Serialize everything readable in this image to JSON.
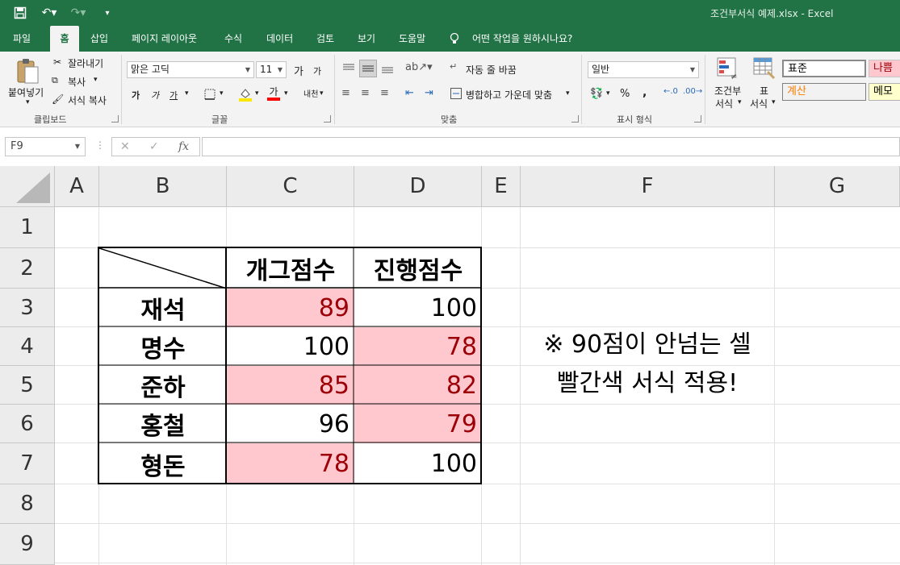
{
  "window": {
    "title": "조건부서식 예제.xlsx  -  Excel"
  },
  "tabs": [
    "파일",
    "홈",
    "삽입",
    "페이지 레이아웃",
    "수식",
    "데이터",
    "검토",
    "보기",
    "도움말"
  ],
  "active_tab": "홈",
  "tell_me": "어떤 작업을 원하시나요?",
  "clipboard": {
    "paste": "붙여넣기",
    "cut": "잘라내기",
    "copy": "복사",
    "format_painter": "서식 복사",
    "label": "클립보드"
  },
  "font": {
    "name": "맑은 고딕",
    "size": "11",
    "grow": "가",
    "shrink": "가",
    "bold": "가",
    "italic": "가",
    "underline": "가",
    "font_color_glyph": "가",
    "phonetic": "내천",
    "label": "글꼴"
  },
  "alignment": {
    "wrap": "자동 줄 바꿈",
    "merge": "병합하고 가운데 맞춤",
    "label": "맞춤"
  },
  "number": {
    "format": "일반",
    "percent": "%",
    "comma": ",",
    "label": "표시 형식"
  },
  "styles": {
    "conditional": [
      "조건부",
      "서식"
    ],
    "table": [
      "표",
      "서식"
    ],
    "normal": "표준",
    "bad": "나쁨",
    "calculation": "계산",
    "note": "메모"
  },
  "name_box": "F9",
  "formula": "",
  "columns": [
    "A",
    "B",
    "C",
    "D",
    "E",
    "F",
    "G"
  ],
  "rows": [
    "1",
    "2",
    "3",
    "4",
    "5",
    "6",
    "7",
    "8",
    "9"
  ],
  "table": {
    "headers": [
      "개그점수",
      "진행점수"
    ],
    "rows": [
      {
        "name": "재석",
        "values": [
          "89",
          "100"
        ]
      },
      {
        "name": "명수",
        "values": [
          "100",
          "78"
        ]
      },
      {
        "name": "준하",
        "values": [
          "85",
          "82"
        ]
      },
      {
        "name": "홍철",
        "values": [
          "96",
          "79"
        ]
      },
      {
        "name": "형돈",
        "values": [
          "78",
          "100"
        ]
      }
    ]
  },
  "note_lines": [
    "※ 90점이 안넘는 셀",
    "빨간색 서식 적용!"
  ],
  "colors": {
    "excel_green": "#217346",
    "bad_fill": "#ffc7ce",
    "bad_text": "#9c0006"
  }
}
